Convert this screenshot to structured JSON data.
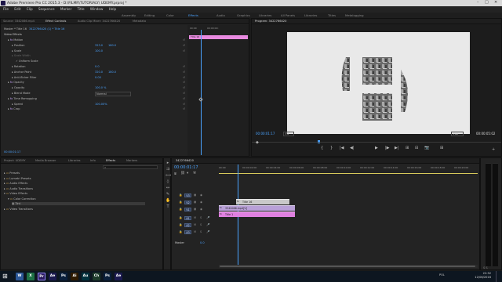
{
  "titlebar": {
    "title": "Adobe Premiere Pro CC 2015.3 - D:\\FILMR\\TUTORIALY\\ UDEMY.prproj *",
    "minimize": "–",
    "maximize": "□",
    "close": "✕"
  },
  "menubar": {
    "items": [
      "File",
      "Edit",
      "Clip",
      "Sequence",
      "Marker",
      "Title",
      "Window",
      "Help"
    ]
  },
  "workspaces": {
    "items": [
      "Assembly",
      "Editing",
      "Color",
      "Effects",
      "Audio",
      "Graphics",
      "Libraries",
      "All Panels",
      "Libraries",
      "Titles",
      "Metalogging"
    ],
    "active_index": 3
  },
  "source_panel": {
    "tabs": [
      "Source: 3342066.mp4",
      "Effect Controls",
      "Audio Clip Mixer: 3422766420",
      "Metadata"
    ],
    "active_tab": 1,
    "header_master": "Master * Title 16",
    "header_sequence": "3422766420 (1) * Title 16",
    "clip_label": "Title 16",
    "section_video_effects": "Video Effects",
    "effects": [
      {
        "name": "Motion",
        "indent": 1,
        "fx": true
      },
      {
        "name": "Position",
        "indent": 2,
        "value": "323.0",
        "value2": "180.0"
      },
      {
        "name": "Scale",
        "indent": 2,
        "value": "100.0"
      },
      {
        "name": "Scale Width",
        "indent": 2,
        "value": "",
        "dim": true
      },
      {
        "name": "Uniform Scale",
        "indent": 3,
        "checkbox": true
      },
      {
        "name": "Rotation",
        "indent": 2,
        "value": "0.0"
      },
      {
        "name": "Anchor Point",
        "indent": 2,
        "value": "320.0",
        "value2": "180.0"
      },
      {
        "name": "Anti-flicker Filter",
        "indent": 2,
        "value": "0.00"
      },
      {
        "name": "Opacity",
        "indent": 1,
        "fx": true
      },
      {
        "name": "Opacity",
        "indent": 2,
        "value": "100.0 %"
      },
      {
        "name": "Blend Mode",
        "indent": 2,
        "dropdown": "Normal"
      },
      {
        "name": "Time Remapping",
        "indent": 1,
        "fx": true
      },
      {
        "name": "Speed",
        "indent": 2,
        "value": "100.00%"
      },
      {
        "name": "Crop",
        "indent": 1,
        "fx": true
      }
    ],
    "timecode": "00:00:01:17",
    "ruler_start": "00:00",
    "ruler_mid": "00:00:00:"
  },
  "program_panel": {
    "title": "Program: 3422766420",
    "timecode_left": "00:00:01:17",
    "fit": "Fit",
    "quality": "Full",
    "timecode_right": "00:00:05:02",
    "transport": [
      "{",
      "}",
      "|◀",
      "◀|",
      "▶",
      "|▶",
      "▶|",
      "⊞",
      "⊟",
      "📷",
      "⊞"
    ]
  },
  "project_panel": {
    "tabs": [
      "Project: UDEMY",
      "Media Browser",
      "Libraries",
      "Info",
      "Effects",
      "Markers"
    ],
    "active_tab": 4,
    "search_placeholder": "",
    "tree": [
      {
        "label": "Presets",
        "indent": 0
      },
      {
        "label": "Lumetri Presets",
        "indent": 0
      },
      {
        "label": "Audio Effects",
        "indent": 0
      },
      {
        "label": "Audio Transitions",
        "indent": 0
      },
      {
        "label": "Video Effects",
        "indent": 0,
        "open": true
      },
      {
        "label": "Color Correction",
        "indent": 1,
        "open": true
      },
      {
        "label": "Tint",
        "indent": 2,
        "selected": true
      },
      {
        "label": "Video Transitions",
        "indent": 0
      }
    ]
  },
  "timeline": {
    "tab": "3422766420",
    "timecode": "00:00:01:17",
    "ruler": [
      "00:00",
      "00:00:02:00",
      "00:00:04:00",
      "00:00:06:00",
      "00:00:08:00",
      "00:00:10:00",
      "00:00:12:00",
      "00:00:14:00",
      "00:00:16:00",
      "00:00:18:00",
      "00:00:20:00"
    ],
    "tracks": [
      {
        "name": "V3"
      },
      {
        "name": "V2"
      },
      {
        "name": "V1"
      },
      {
        "name": "A1"
      },
      {
        "name": "A2"
      },
      {
        "name": "A3"
      }
    ],
    "master_label": "Master",
    "master_value": "0.0",
    "clips": [
      {
        "label": "Title 16",
        "track": "V3",
        "color": "#c9c9c9"
      },
      {
        "label": "3342066.mp4[V]",
        "track": "V2",
        "color": "#b9a0d8"
      },
      {
        "label": "Title 1",
        "track": "V1",
        "color": "#e080e0"
      }
    ]
  },
  "taskbar": {
    "icons": [
      "W",
      "X",
      "Pr",
      "Ae",
      "Ps",
      "Ai",
      "Au",
      "Ch",
      "Ps",
      "Ae"
    ],
    "clock": "22:32",
    "date": "12/06/2016",
    "lang": "POL"
  },
  "colors": {
    "accent": "#4aa3ff",
    "clip_title": "#e080e0",
    "clip_video": "#b9a0d8",
    "clip_v3": "#c9c9c9",
    "timeline_bar": "#d6c85a"
  }
}
